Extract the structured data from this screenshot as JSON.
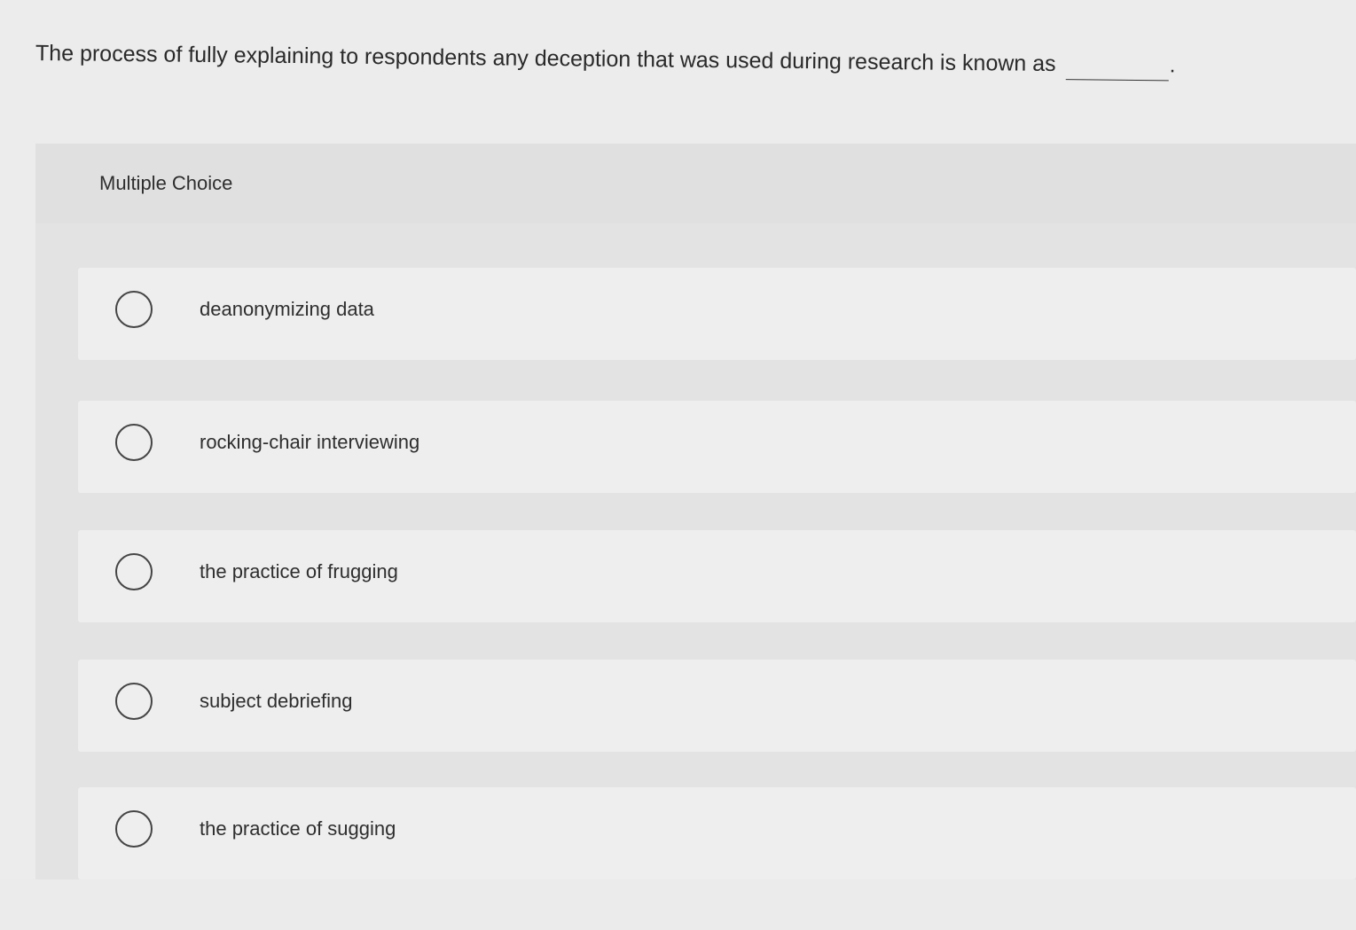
{
  "question": {
    "text": "The process of fully explaining to respondents any deception that was used during research is known as",
    "end": "."
  },
  "multiple_choice": {
    "title": "Multiple Choice",
    "options": [
      {
        "label": "deanonymizing data",
        "selected": false
      },
      {
        "label": "rocking-chair interviewing",
        "selected": false
      },
      {
        "label": "the practice of frugging",
        "selected": false
      },
      {
        "label": "subject debriefing",
        "selected": false
      },
      {
        "label": "the practice of sugging",
        "selected": false
      }
    ]
  },
  "colors": {
    "background": "#ececec",
    "panel": "#e3e3e3",
    "option": "#eeeeee",
    "text": "#2e2e2e"
  }
}
